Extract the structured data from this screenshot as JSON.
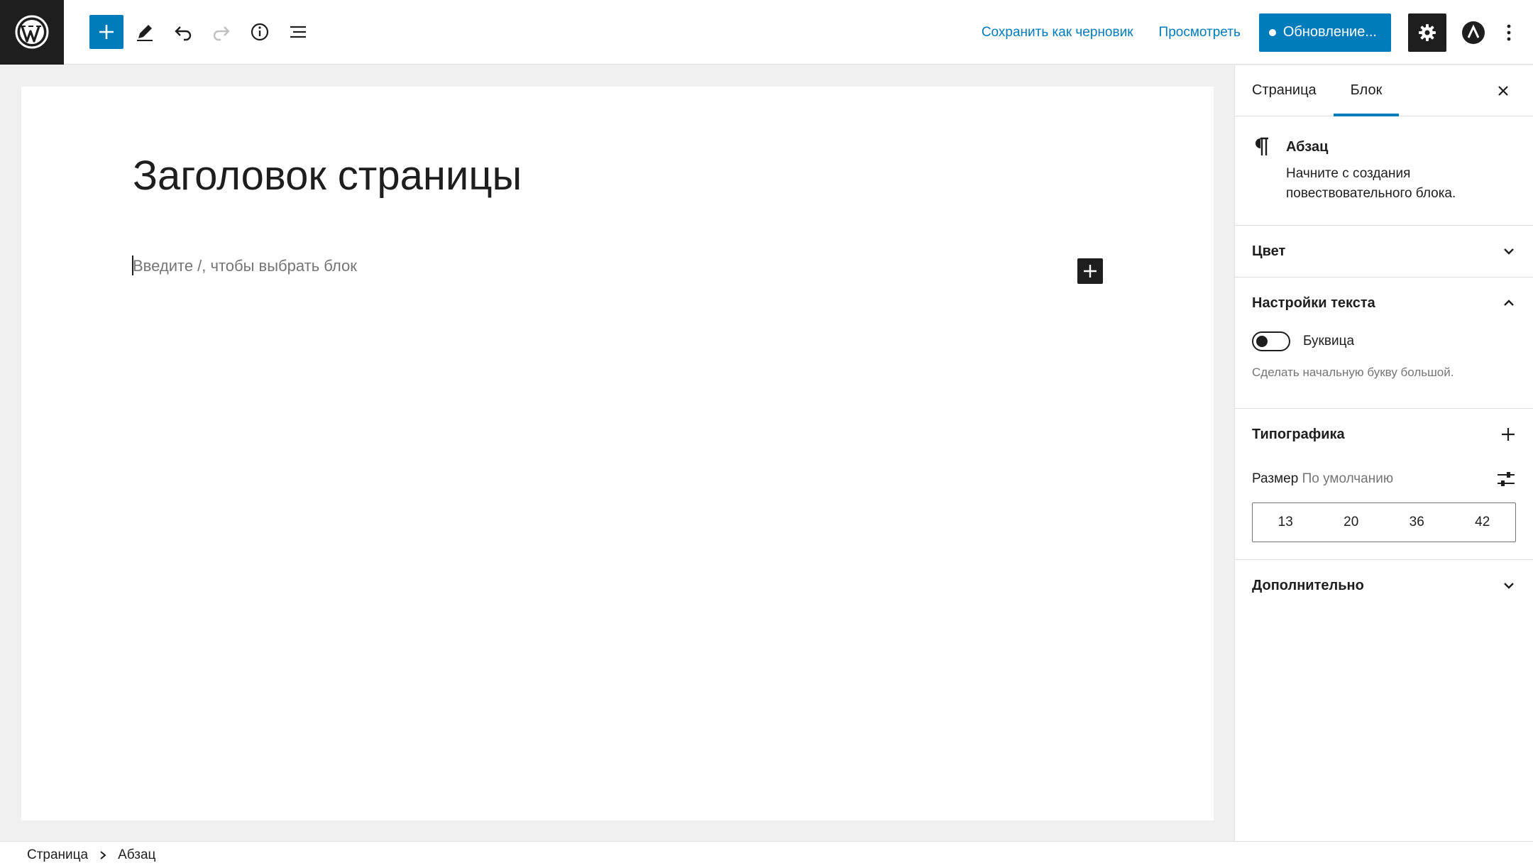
{
  "header": {
    "save_draft": "Сохранить как черновик",
    "preview": "Просмотреть",
    "update": "Обновление..."
  },
  "editor": {
    "title": "Заголовок страницы",
    "placeholder": "Введите /, чтобы выбрать блок"
  },
  "sidebar": {
    "tabs": [
      {
        "label": "Страница",
        "active": false
      },
      {
        "label": "Блок",
        "active": true
      }
    ],
    "block_card": {
      "title": "Абзац",
      "description": "Начните с создания повествовательного блока."
    },
    "panels": {
      "color": {
        "title": "Цвет",
        "expanded": false
      },
      "text_settings": {
        "title": "Настройки текста",
        "expanded": true,
        "drop_cap_label": "Буквица",
        "drop_cap_enabled": false,
        "drop_cap_help": "Сделать начальную букву большой."
      },
      "typography": {
        "title": "Типографика",
        "size_label": "Размер",
        "size_value": "По умолчанию",
        "sizes": [
          "13",
          "20",
          "36",
          "42"
        ]
      },
      "advanced": {
        "title": "Дополнительно",
        "expanded": false
      }
    }
  },
  "breadcrumbs": [
    "Страница",
    "Абзац"
  ],
  "colors": {
    "accent": "#007cba",
    "dark": "#1e1e1e",
    "muted": "#757575"
  }
}
